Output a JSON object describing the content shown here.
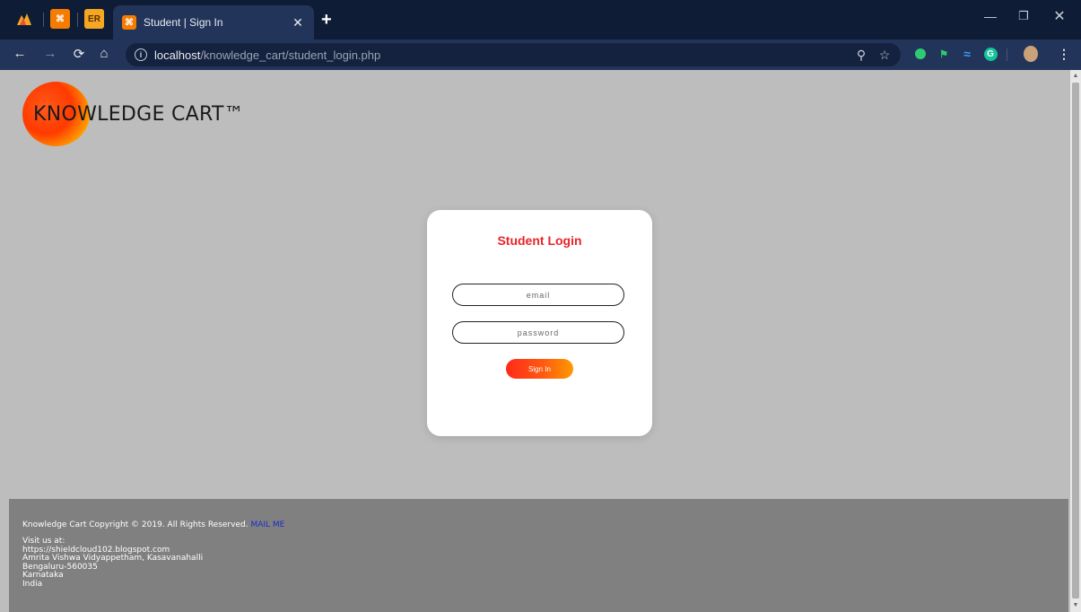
{
  "browser": {
    "pinned_tabs": [
      {
        "icon": "mountain-icon",
        "label": ""
      },
      {
        "icon": "xampp-icon",
        "label": "⌘"
      },
      {
        "icon": "er-icon",
        "label": "ER"
      }
    ],
    "active_tab": {
      "title": "Student | Sign In",
      "favicon": "xampp-icon"
    },
    "url": {
      "host": "localhost",
      "path": "/knowledge_cart/student_login.php"
    },
    "colors": {
      "tabbar": "#0f1c36",
      "toolbar": "#22345a"
    }
  },
  "site": {
    "logo_text": "KNOWLEDGE CART™"
  },
  "login": {
    "title": "Student Login",
    "email_placeholder": "email",
    "password_placeholder": "password",
    "signin_label": "Sign In",
    "title_color": "#e8242a"
  },
  "footer": {
    "copyright": "Knowledge Cart Copyright © 2019. All Rights Reserved.",
    "mail_link": "MAIL ME",
    "visit_lines": [
      "Visit us at:",
      "https://shieldcloud102.blogspot.com",
      "Amrita Vishwa Vidyappetham, Kasavanahalli",
      "Bengaluru-560035",
      "Karnataka",
      "India"
    ]
  }
}
